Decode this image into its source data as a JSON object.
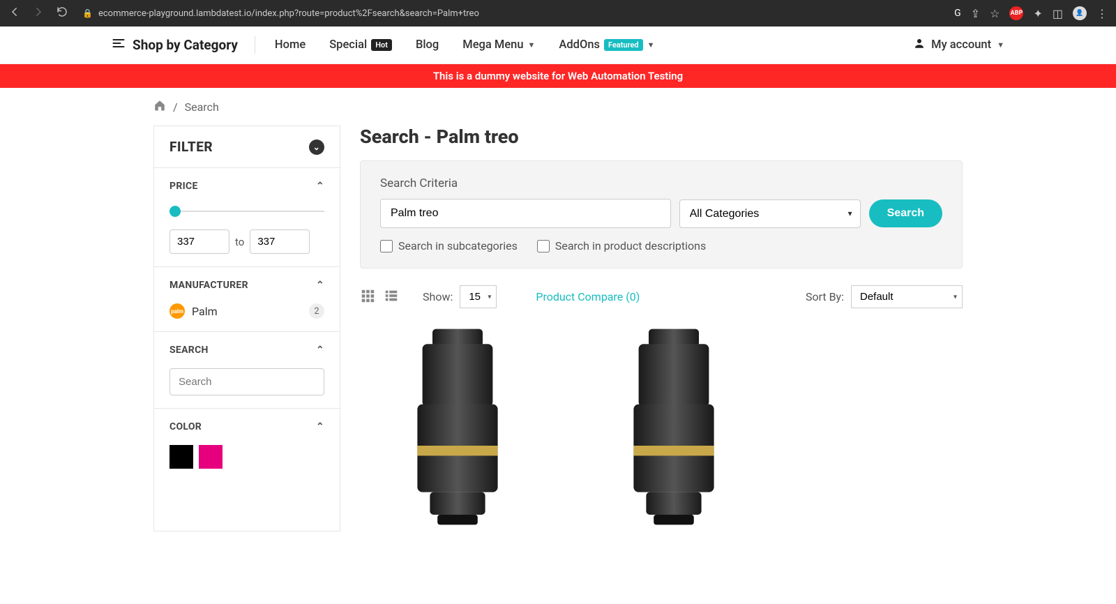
{
  "browser": {
    "url": "ecommerce-playground.lambdatest.io/index.php?route=product%2Fsearch&search=Palm+treo",
    "abp": "ABP"
  },
  "nav": {
    "shop_by": "Shop by Category",
    "home": "Home",
    "special": "Special",
    "special_badge": "Hot",
    "blog": "Blog",
    "mega": "Mega Menu",
    "addons": "AddOns",
    "addons_badge": "Featured",
    "account": "My account"
  },
  "banner": "This is a dummy website for Web Automation Testing",
  "breadcrumb": {
    "sep": "/",
    "search": "Search"
  },
  "sidebar": {
    "filter": "FILTER",
    "price": {
      "title": "PRICE",
      "min": "337",
      "to": "to",
      "max": "337"
    },
    "manufacturer": {
      "title": "MANUFACTURER",
      "name": "Palm",
      "logo": "palm",
      "count": "2"
    },
    "search": {
      "title": "SEARCH",
      "placeholder": "Search"
    },
    "color": {
      "title": "COLOR",
      "swatches": [
        "#000000",
        "#e6007e"
      ]
    }
  },
  "main": {
    "title": "Search - Palm treo",
    "criteria_label": "Search Criteria",
    "search_value": "Palm treo",
    "category": "All Categories",
    "search_btn": "Search",
    "check_sub": "Search in subcategories",
    "check_desc": "Search in product descriptions",
    "show_label": "Show:",
    "show_value": "15",
    "compare": "Product Compare (0)",
    "sort_label": "Sort By:",
    "sort_value": "Default"
  }
}
